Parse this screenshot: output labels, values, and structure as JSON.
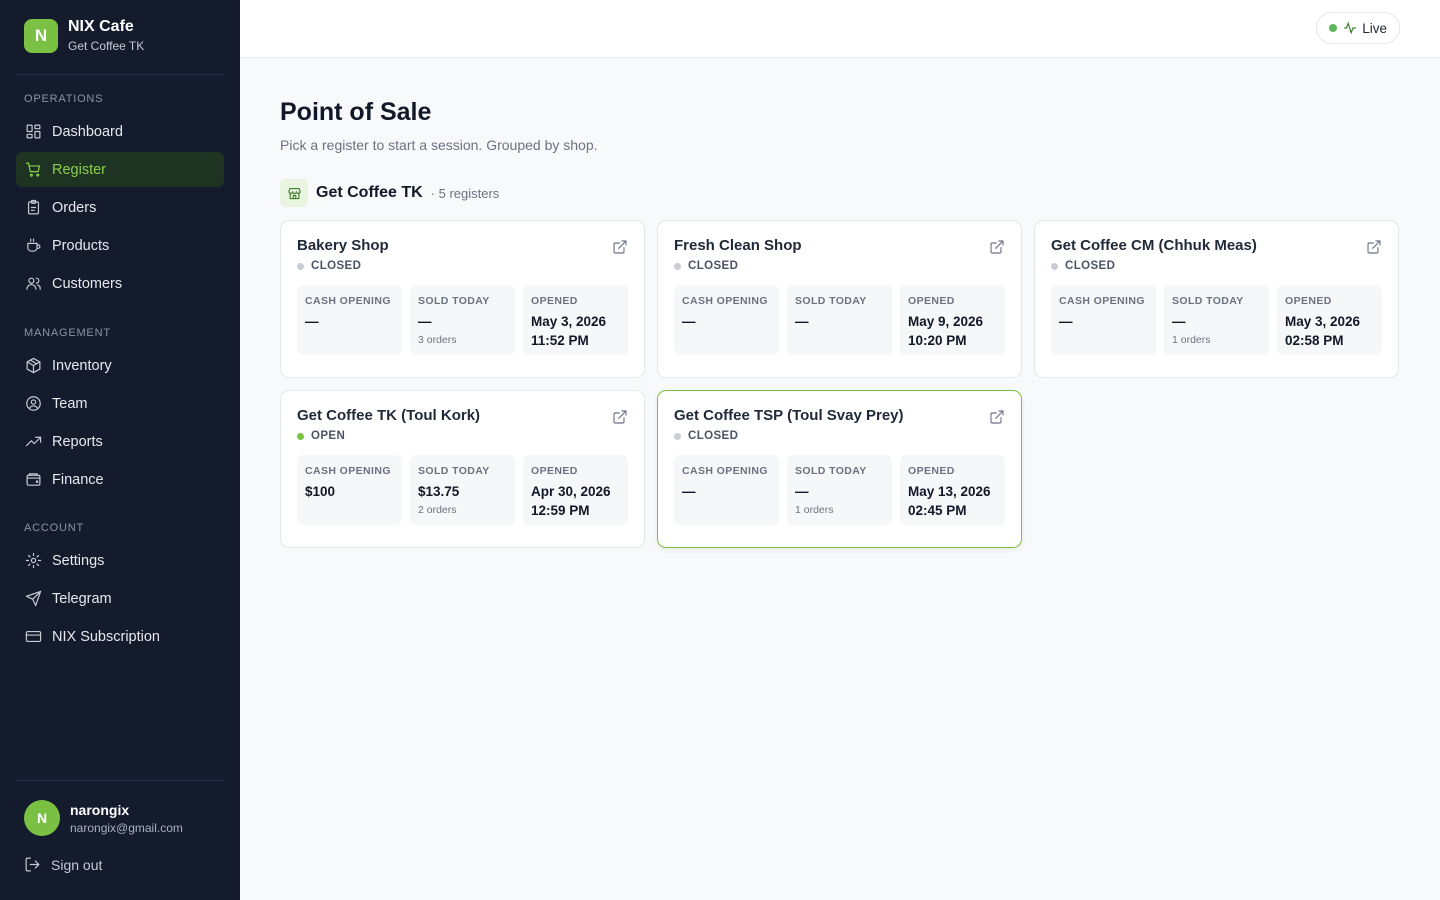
{
  "brand": {
    "logo_letter": "N",
    "name": "NIX Cafe",
    "subtitle": "Get Coffee TK"
  },
  "nav": {
    "operations": {
      "heading": "Operations",
      "items": [
        {
          "label": "Dashboard",
          "icon": "dashboard-icon"
        },
        {
          "label": "Register",
          "icon": "cart-icon",
          "active": true
        },
        {
          "label": "Orders",
          "icon": "clipboard-icon"
        },
        {
          "label": "Products",
          "icon": "cup-icon"
        },
        {
          "label": "Customers",
          "icon": "users-icon"
        }
      ]
    },
    "management": {
      "heading": "Management",
      "items": [
        {
          "label": "Inventory",
          "icon": "package-icon"
        },
        {
          "label": "Team",
          "icon": "user-circle-icon"
        },
        {
          "label": "Reports",
          "icon": "trending-up-icon"
        },
        {
          "label": "Finance",
          "icon": "wallet-icon"
        }
      ]
    },
    "account": {
      "heading": "Account",
      "items": [
        {
          "label": "Settings",
          "icon": "gear-icon"
        },
        {
          "label": "Telegram",
          "icon": "send-icon"
        },
        {
          "label": "NIX Subscription",
          "icon": "credit-card-icon"
        }
      ]
    }
  },
  "user": {
    "initial": "N",
    "name": "narongix",
    "email": "narongix@gmail.com",
    "signout": "Sign out"
  },
  "topbar": {
    "live_label": "Live"
  },
  "page": {
    "title": "Point of Sale",
    "subtitle": "Pick a register to start a session. Grouped by shop."
  },
  "group": {
    "name": "Get Coffee TK",
    "count": "· 5 registers"
  },
  "stat_labels": {
    "cash": "CASH OPENING",
    "sold": "SOLD TODAY",
    "opened": "OPENED"
  },
  "registers": [
    {
      "name": "Bakery Shop",
      "status": "CLOSED",
      "cash": "—",
      "sold": "—",
      "orders": "3 orders",
      "opened_date": "May 3, 2026",
      "opened_time": "11:52 PM"
    },
    {
      "name": "Fresh Clean Shop",
      "status": "CLOSED",
      "cash": "—",
      "sold": "—",
      "orders": "",
      "opened_date": "May 9, 2026",
      "opened_time": "10:20 PM"
    },
    {
      "name": "Get Coffee CM (Chhuk Meas)",
      "status": "CLOSED",
      "cash": "—",
      "sold": "—",
      "orders": "1 orders",
      "opened_date": "May 3, 2026",
      "opened_time": "02:58 PM"
    },
    {
      "name": "Get Coffee TK (Toul Kork)",
      "status": "OPEN",
      "cash": "$100",
      "sold": "$13.75",
      "orders": "2 orders",
      "opened_date": "Apr 30, 2026",
      "opened_time": "12:59 PM"
    },
    {
      "name": "Get Coffee TSP (Toul Svay Prey)",
      "status": "CLOSED",
      "cash": "—",
      "sold": "—",
      "orders": "1 orders",
      "opened_date": "May 13, 2026",
      "opened_time": "02:45 PM",
      "highlighted": true
    }
  ],
  "colors": {
    "accent": "#7ac143",
    "sidebar_bg": "#141b2d",
    "active_bg": "#1f3323",
    "active_text": "#8bd04f"
  }
}
